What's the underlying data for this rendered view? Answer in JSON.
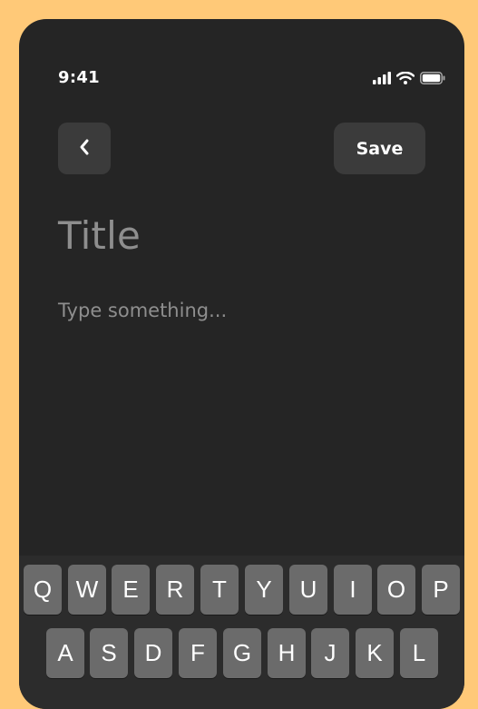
{
  "status_bar": {
    "time": "9:41",
    "icons": [
      "signal-icon",
      "wifi-icon",
      "battery-icon"
    ]
  },
  "header": {
    "back_icon": "chevron-left-icon",
    "save_label": "Save"
  },
  "editor": {
    "title_placeholder": "Title",
    "body_placeholder": "Type something..."
  },
  "keyboard": {
    "row1": [
      "Q",
      "W",
      "E",
      "R",
      "T",
      "Y",
      "U",
      "I",
      "O",
      "P"
    ],
    "row2": [
      "A",
      "S",
      "D",
      "F",
      "G",
      "H",
      "J",
      "K",
      "L"
    ]
  },
  "colors": {
    "background": "#FFC978",
    "screen": "#252525",
    "button": "#3B3B3B",
    "placeholder": "#8E8E8E",
    "key": "#6B6B6B"
  }
}
